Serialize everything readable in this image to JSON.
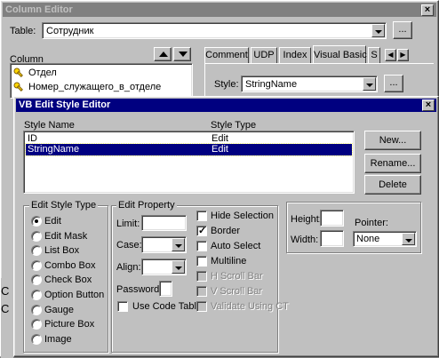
{
  "column_editor": {
    "title": "Column Editor",
    "table_label": "Table:",
    "table_value": "Сотрудник",
    "browse": "...",
    "column_label": "Column",
    "columns": [
      "Отдел",
      "Номер_служащего_в_отделе"
    ],
    "tabs": [
      "Comment",
      "UDP",
      "Index",
      "Visual Basic",
      "S"
    ],
    "style_label": "Style:",
    "style_value": "StringName",
    "style_browse": "...",
    "partial_text_1": "C",
    "partial_text_2": "C"
  },
  "vb_editor": {
    "title": "VB Edit Style Editor",
    "col_style_name": "Style Name",
    "col_style_type": "Style Type",
    "rows": [
      {
        "name": "ID",
        "type": "Edit"
      },
      {
        "name": "StringName",
        "type": "Edit"
      }
    ],
    "selected_row": 1,
    "buttons": {
      "new": "New...",
      "rename": "Rename...",
      "delete": "Delete"
    },
    "edit_style_type": {
      "label": "Edit Style Type",
      "options": [
        "Edit",
        "Edit Mask",
        "List Box",
        "Combo Box",
        "Check Box",
        "Option Button",
        "Gauge",
        "Picture Box",
        "Image"
      ],
      "selected": 0
    },
    "edit_property": {
      "label": "Edit Property",
      "limit_label": "Limit:",
      "limit_value": "",
      "case_label": "Case:",
      "case_value": "",
      "align_label": "Align:",
      "align_value": "",
      "password_label": "Password:",
      "password_value": "",
      "use_code_table": "Use Code Table",
      "checks": [
        {
          "label": "Hide Selection",
          "checked": false,
          "disabled": false
        },
        {
          "label": "Border",
          "checked": true,
          "disabled": false
        },
        {
          "label": "Auto Select",
          "checked": false,
          "disabled": false
        },
        {
          "label": "Multiline",
          "checked": false,
          "disabled": false
        },
        {
          "label": "H Scroll Bar",
          "checked": false,
          "disabled": true
        },
        {
          "label": "V Scroll Bar",
          "checked": false,
          "disabled": true
        },
        {
          "label": "Validate Using CT",
          "checked": false,
          "disabled": true
        }
      ]
    },
    "height_label": "Height:",
    "height_value": "",
    "width_label": "Width:",
    "width_value": "",
    "pointer_label": "Pointer:",
    "pointer_value": "None"
  },
  "colors": {
    "title_active": "#000080",
    "selection": "#000080",
    "face": "#c0c0c0"
  }
}
